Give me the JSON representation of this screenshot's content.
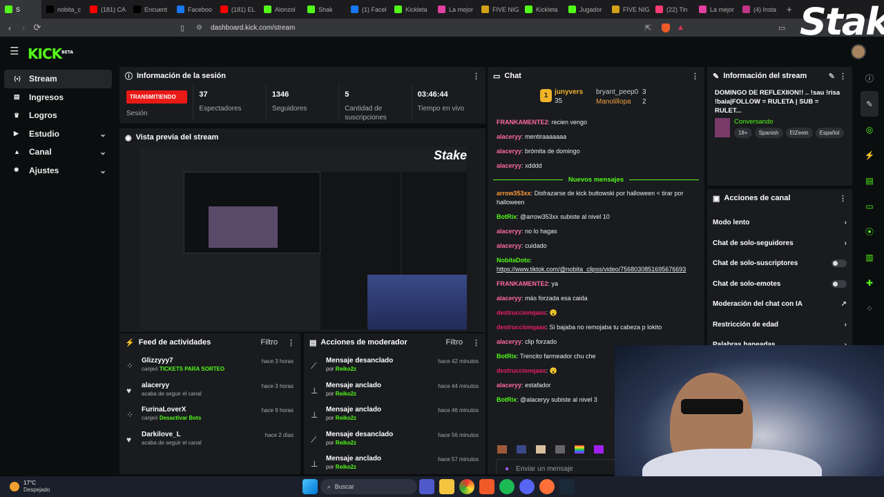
{
  "browser": {
    "tabs": [
      {
        "label": "S",
        "color": "#53fc18",
        "active": true
      },
      {
        "label": "nobita_c",
        "color": "#000000"
      },
      {
        "label": "(181) CA",
        "color": "#ff0000"
      },
      {
        "label": "Encuent",
        "color": "#000000"
      },
      {
        "label": "Faceboo",
        "color": "#1877f2"
      },
      {
        "label": "(181) EL",
        "color": "#ff0000"
      },
      {
        "label": "Alonzol",
        "color": "#53fc18"
      },
      {
        "label": "Shak",
        "color": "#53fc18"
      },
      {
        "label": "(1) Facel",
        "color": "#1877f2"
      },
      {
        "label": "Kickleta",
        "color": "#53fc18"
      },
      {
        "label": "La mejor",
        "color": "#e040a0"
      },
      {
        "label": "FIVE NIG",
        "color": "#d4a017"
      },
      {
        "label": "Kickleta",
        "color": "#53fc18"
      },
      {
        "label": "Jugador",
        "color": "#53fc18"
      },
      {
        "label": "FIVE NIG",
        "color": "#d4a017"
      },
      {
        "label": "(22) Tin",
        "color": "#fe3c72"
      },
      {
        "label": "La mejor",
        "color": "#e040a0"
      },
      {
        "label": "(4) Insta",
        "color": "#c13584"
      }
    ],
    "url": "dashboard.kick.com/stream"
  },
  "logo": {
    "text": "KICK",
    "badge": "BETA"
  },
  "sidebar": {
    "items": [
      {
        "label": "Stream",
        "icon": "broadcast-icon",
        "active": true
      },
      {
        "label": "Ingresos",
        "icon": "receipt-icon"
      },
      {
        "label": "Logros",
        "icon": "trophy-icon"
      },
      {
        "label": "Estudio",
        "icon": "film-icon",
        "chevron": true
      },
      {
        "label": "Canal",
        "icon": "user-icon",
        "chevron": true
      },
      {
        "label": "Ajustes",
        "icon": "gear-icon",
        "chevron": true
      }
    ]
  },
  "session": {
    "title": "Información de la sesión",
    "live_badge": "TRANSMITIENDO",
    "session_label": "Sesión",
    "stats": [
      {
        "value": "37",
        "label": "Espectadores"
      },
      {
        "value": "1346",
        "label": "Seguidores"
      },
      {
        "value": "5",
        "label": "Cantidad de suscripciones"
      },
      {
        "value": "03:46:44",
        "label": "Tiempo en vivo"
      }
    ]
  },
  "preview": {
    "title": "Vista previa del stream"
  },
  "feed": {
    "title": "Feed de actividades",
    "filter": "Filtro",
    "rows": [
      {
        "name": "Glizzyyy7",
        "action": "canjeó",
        "highlight": "TICKETS PARA SORTEO",
        "time": "hace 3 horas"
      },
      {
        "name": "alaceryy",
        "action": "acaba de seguir el canal",
        "highlight": "",
        "time": "hace 3 horas"
      },
      {
        "name": "FurinaLoverX",
        "action": "canjeó",
        "highlight": "Desactivar Bots",
        "time": "hace 9 horas"
      },
      {
        "name": "Darkilove_L",
        "action": "acaba de seguir el canal",
        "highlight": "",
        "time": "hace 2 días"
      }
    ]
  },
  "mod": {
    "title": "Acciones de moderador",
    "filter": "Filtro",
    "rows": [
      {
        "action": "Mensaje desanclado",
        "by": "por",
        "user": "Reiko2z",
        "time": "hace 42 minutos"
      },
      {
        "action": "Mensaje anclado",
        "by": "por",
        "user": "Reiko2z",
        "time": "hace 44 minutos"
      },
      {
        "action": "Mensaje anclado",
        "by": "por",
        "user": "Reiko2z",
        "time": "hace 46 minutos"
      },
      {
        "action": "Mensaje desanclado",
        "by": "por",
        "user": "Reiko2z",
        "time": "hace 56 minutos"
      },
      {
        "action": "Mensaje anclado",
        "by": "por",
        "user": "Reiko2z",
        "time": "hace 57 minutos"
      }
    ]
  },
  "chat": {
    "title": "Chat",
    "leaderboard": {
      "first": "junyvers",
      "first_count": "35",
      "second": "bryant_peep0",
      "second_count": "3",
      "third": "Manolillopa",
      "third_count": "2"
    },
    "new_messages": "Nuevos mensajes",
    "messages_before": [
      {
        "user": "FRANKAMENTE2",
        "color": "#ff6b9d",
        "text": "recien vengo"
      },
      {
        "user": "alaceryy",
        "color": "#ff6b9d",
        "text": "mentiraaaaaaa"
      },
      {
        "user": "alaceryy",
        "color": "#ff6b9d",
        "text": "brómita de domingo"
      },
      {
        "user": "alaceryy",
        "color": "#ff6b9d",
        "text": "xdddd"
      }
    ],
    "messages_after": [
      {
        "user": "arrow353xx",
        "color": "#ff9a3c",
        "text": "Disfrazarse de kick buttowski por halloween < tirar por halloween"
      },
      {
        "user": "BotRix",
        "color": "#53fc18",
        "text": "@arrow353xx subiste al nivel 10"
      },
      {
        "user": "alaceryy",
        "color": "#ff6b9d",
        "text": "no lo hagas"
      },
      {
        "user": "alaceryy",
        "color": "#ff6b9d",
        "text": "cuidado"
      },
      {
        "user": "NobitaDoto",
        "color": "#53fc18",
        "text": "https://www.tiktok.com/@nobita_clipss/video/7568030851695676693"
      },
      {
        "user": "FRANKAMENTE2",
        "color": "#ff6b9d",
        "text": "ya"
      },
      {
        "user": "alaceryy",
        "color": "#ff6b9d",
        "text": "más forzada esa caida"
      },
      {
        "user": "destruccionqaas",
        "color": "#e91e63",
        "text": "😮"
      },
      {
        "user": "destruccionqaas",
        "color": "#e91e63",
        "text": "Si bajaba no remojaba tu cabeza p lokito"
      },
      {
        "user": "alaceryy",
        "color": "#ff6b9d",
        "text": "clip forzado"
      },
      {
        "user": "BotRix",
        "color": "#53fc18",
        "text": "Trencito farmeador chu che"
      },
      {
        "user": "destruccionqaas",
        "color": "#e91e63",
        "text": "😮"
      },
      {
        "user": "alaceryy",
        "color": "#ff6b9d",
        "text": "estafador"
      },
      {
        "user": "BotRix",
        "color": "#53fc18",
        "text": "@alaceryy subiste al nivel 3"
      }
    ],
    "input_placeholder": "Enviar un mensaje"
  },
  "stream_info": {
    "title": "Información del stream",
    "stream_title": "DOMINGO DE REFLEXIION!! .. !sau !risa !baia|FOLLOW = RULETA | SUB = RULET...",
    "category": "Conversando",
    "tags": [
      "18+",
      "Spanish",
      "ElZeein",
      "Español"
    ]
  },
  "channel_actions": {
    "title": "Acciones de canal",
    "items": [
      {
        "label": "Modo lento",
        "control": "chevron"
      },
      {
        "label": "Chat de solo-seguidores",
        "control": "chevron"
      },
      {
        "label": "Chat de solo-suscriptores",
        "control": "toggle"
      },
      {
        "label": "Chat de solo-emotes",
        "control": "toggle"
      },
      {
        "label": "Moderación del chat con IA",
        "control": "external"
      },
      {
        "label": "Restricción de edad",
        "control": "chevron"
      },
      {
        "label": "Palabras baneadas",
        "control": "chevron"
      }
    ]
  },
  "overlay": {
    "brand": "Stake"
  },
  "taskbar": {
    "weather_temp": "17°C",
    "weather_desc": "Despejado",
    "search_placeholder": "Buscar"
  }
}
